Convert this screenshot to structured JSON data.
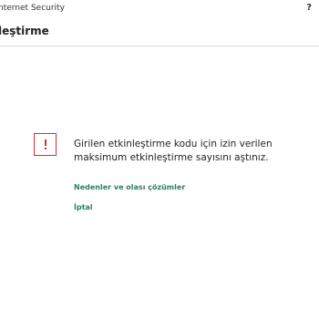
{
  "window": {
    "title": "nternet Security",
    "help_icon": "?"
  },
  "page": {
    "heading": "leştirme"
  },
  "alert": {
    "icon": "warning-icon",
    "icon_color": "#d32f2f",
    "message": "Girilen etkinleştirme kodu için izin verilen maksimum etkinleştirme sayısını aştınız."
  },
  "links": {
    "reasons_label": "Nedenler ve olası çözümler",
    "cancel_label": "İptal",
    "color": "#2e7d62"
  }
}
